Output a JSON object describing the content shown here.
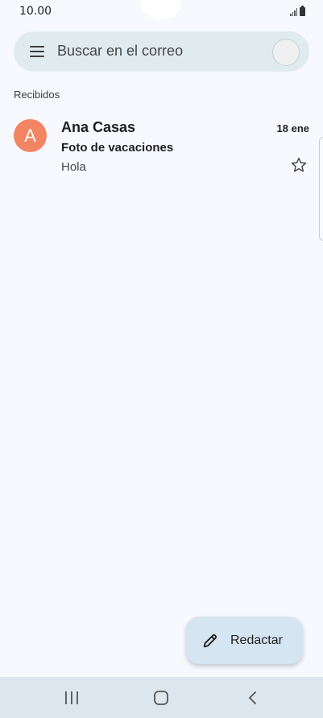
{
  "status_bar": {
    "time": "10.00"
  },
  "search": {
    "placeholder": "Buscar en el correo"
  },
  "section": {
    "label": "Recibidos"
  },
  "emails": [
    {
      "avatar_letter": "A",
      "sender": "Ana Casas",
      "date": "18 ene",
      "subject": "Foto de vacaciones",
      "snippet": "Hola",
      "avatar_color": "#f28563",
      "starred": false
    }
  ],
  "compose": {
    "label": "Redactar"
  },
  "icons": {
    "menu": "menu-icon",
    "star": "star-outline-icon",
    "compose": "pencil-icon",
    "signal": "signal-icon",
    "battery": "battery-icon",
    "nav_recents": "recents-icon",
    "nav_home": "home-icon",
    "nav_back": "back-icon"
  },
  "colors": {
    "background": "#f8f9fe",
    "search_bar": "#e0ebf0",
    "compose_button": "#d5e6f2",
    "nav_bar": "#dbe6ee"
  }
}
